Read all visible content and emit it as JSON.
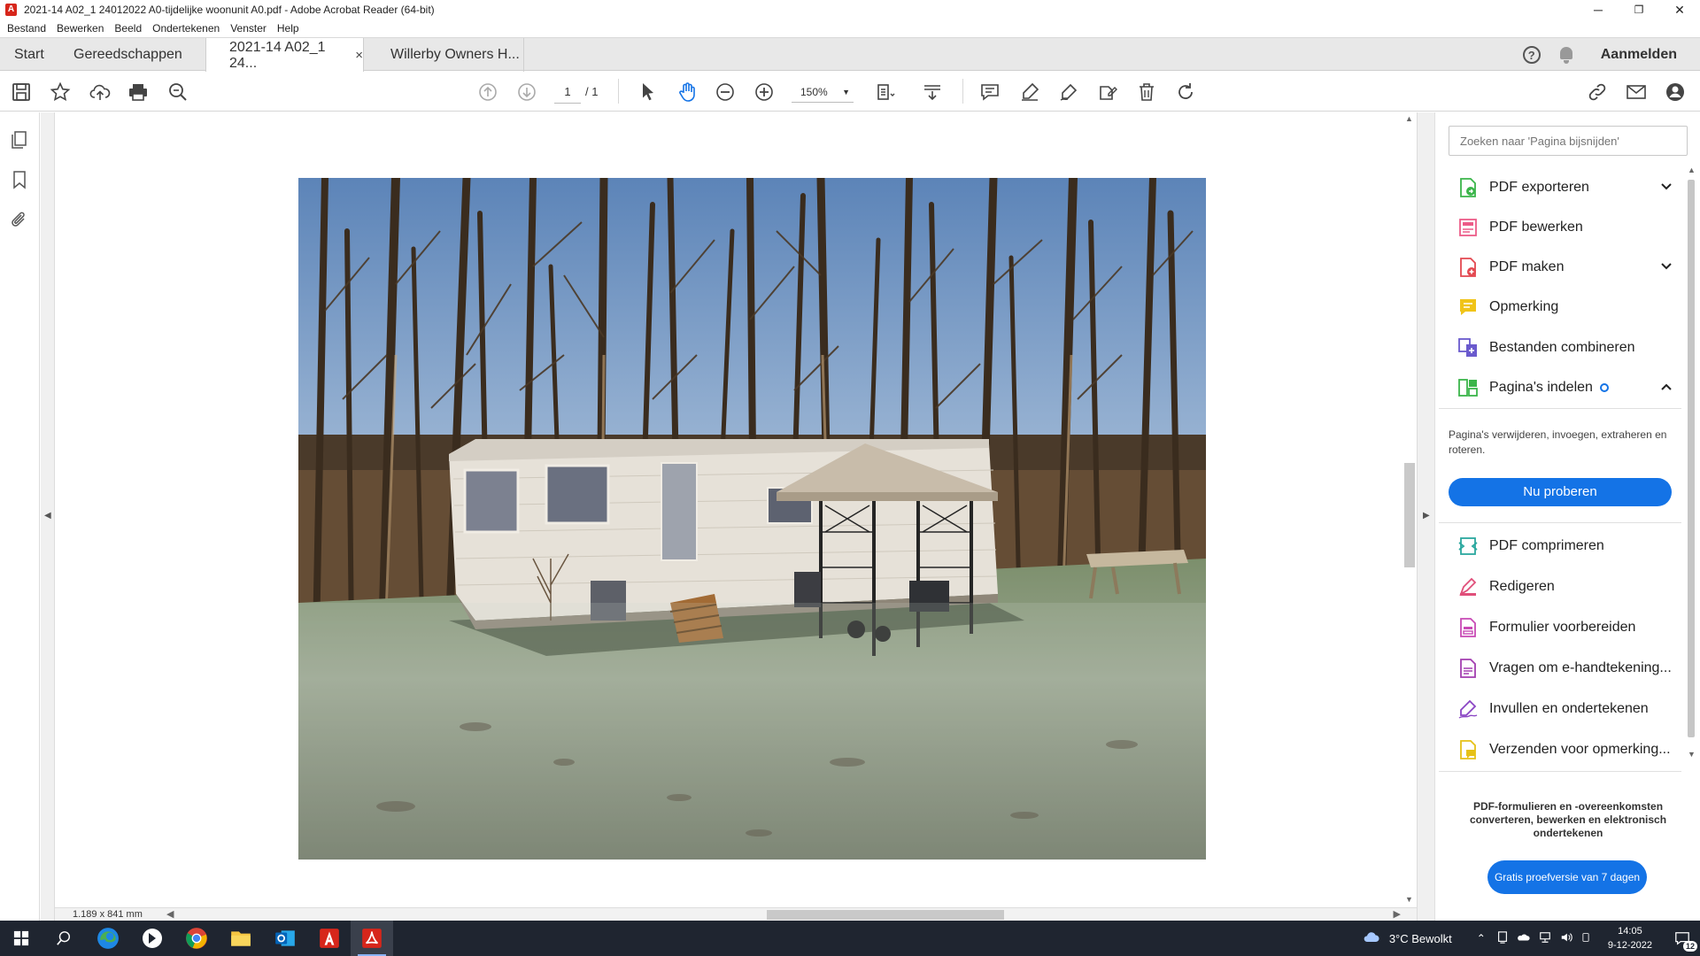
{
  "window": {
    "title": "2021-14 A02_1 24012022 A0-tijdelijke woonunit A0.pdf - Adobe Acrobat Reader (64-bit)",
    "minimize": "─",
    "maximize": "❐",
    "close": "✕"
  },
  "menu": [
    "Bestand",
    "Bewerken",
    "Beeld",
    "Ondertekenen",
    "Venster",
    "Help"
  ],
  "tabs": {
    "home": "Start",
    "tools": "Gereedschappen",
    "doc1": "2021-14 A02_1 24...",
    "doc1_close": "×",
    "doc2": "Willerby Owners H...",
    "help": "?",
    "signin": "Aanmelden"
  },
  "toolbar": {
    "page_current": "1",
    "page_total": "/ 1",
    "zoom": "150%"
  },
  "status": {
    "page_size": "1.189 x 841 mm"
  },
  "right_panel": {
    "search_placeholder": "Zoeken naar 'Pagina bijsnijden'",
    "tools": [
      {
        "label": "PDF exporteren",
        "icon": "export-pdf-icon",
        "color": "#e34850"
      },
      {
        "label": "PDF bewerken",
        "icon": "edit-pdf-icon",
        "color": "#ec5c88"
      },
      {
        "label": "PDF maken",
        "icon": "create-pdf-icon",
        "color": "#e34850"
      },
      {
        "label": "Opmerking",
        "icon": "comment-icon",
        "color": "#e6c117"
      },
      {
        "label": "Bestanden combineren",
        "icon": "combine-files-icon",
        "color": "#6a5acd"
      },
      {
        "label": "Pagina's indelen",
        "icon": "organize-pages-icon",
        "color": "#3bb54a"
      }
    ],
    "organize_desc": "Pagina's verwijderen, invoegen, extraheren en roteren.",
    "try_button": "Nu proberen",
    "tools2": [
      {
        "label": "PDF comprimeren",
        "icon": "compress-pdf-icon",
        "color": "#2ba89f"
      },
      {
        "label": "Redigeren",
        "icon": "redact-icon",
        "color": "#e04f7a"
      },
      {
        "label": "Formulier voorbereiden",
        "icon": "prepare-form-icon",
        "color": "#c84ab5"
      },
      {
        "label": "Vragen om e-handtekening...",
        "icon": "request-signature-icon",
        "color": "#a33fb0"
      },
      {
        "label": "Invullen en ondertekenen",
        "icon": "fill-sign-icon",
        "color": "#8a45c4"
      },
      {
        "label": "Verzenden voor opmerking...",
        "icon": "send-comments-icon",
        "color": "#e6c117"
      }
    ],
    "promo": "PDF-formulieren en -overeenkomsten converteren, bewerken en elektronisch ondertekenen",
    "trial_button": "Gratis proefversie van 7 dagen"
  },
  "taskbar": {
    "weather": "3°C  Bewolkt",
    "time": "14:05",
    "date": "9-12-2022",
    "notifications": "12"
  }
}
